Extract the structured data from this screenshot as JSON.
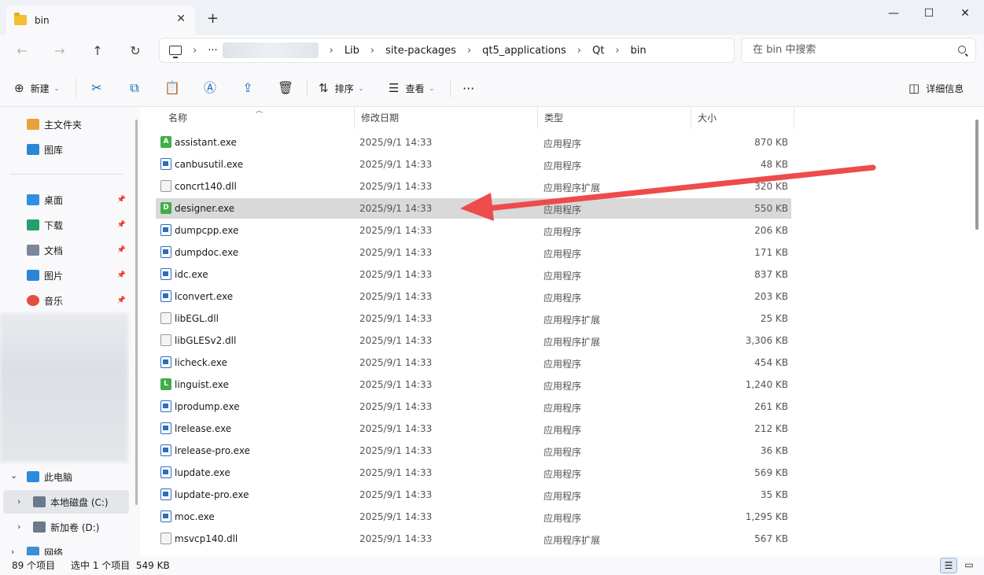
{
  "window": {
    "tab_title": "bin",
    "tab_close": "✕",
    "new_tab": "+",
    "controls": {
      "minimize": "—",
      "maximize": "☐",
      "close": "✕"
    }
  },
  "nav": {
    "back": "←",
    "forward": "→",
    "up": "↑",
    "refresh": "↻"
  },
  "address": {
    "ellipsis": "···",
    "crumbs": [
      "Lib",
      "site-packages",
      "qt5_applications",
      "Qt",
      "bin"
    ],
    "separator": "›"
  },
  "search": {
    "placeholder": "在 bin 中搜索"
  },
  "toolbar": {
    "new_label": "新建",
    "sort_label": "排序",
    "view_label": "查看",
    "more_label": "···",
    "details_label": "详细信息"
  },
  "sidebar": {
    "home": "主文件夹",
    "gallery": "图库",
    "quick": [
      {
        "label": "桌面",
        "color": "#2f8fe0"
      },
      {
        "label": "下载",
        "color": "#23a06b"
      },
      {
        "label": "文档",
        "color": "#7a8899"
      },
      {
        "label": "图片",
        "color": "#2b86d6"
      },
      {
        "label": "音乐",
        "color": "#e2503f"
      }
    ],
    "this_pc": "此电脑",
    "drive_c": "本地磁盘 (C:)",
    "drive_d": "新加卷 (D:)",
    "network": "网络"
  },
  "columns": {
    "name": "名称",
    "date": "修改日期",
    "type": "类型",
    "size": "大小"
  },
  "files": [
    {
      "name": "assistant.exe",
      "date": "2025/9/1 14:33",
      "type": "应用程序",
      "size": "870 KB",
      "icon": "green-a"
    },
    {
      "name": "canbusutil.exe",
      "date": "2025/9/1 14:33",
      "type": "应用程序",
      "size": "48 KB",
      "icon": "exe"
    },
    {
      "name": "concrt140.dll",
      "date": "2025/9/1 14:33",
      "type": "应用程序扩展",
      "size": "320 KB",
      "icon": "dll"
    },
    {
      "name": "designer.exe",
      "date": "2025/9/1 14:33",
      "type": "应用程序",
      "size": "550 KB",
      "icon": "green-d",
      "selected": true
    },
    {
      "name": "dumpcpp.exe",
      "date": "2025/9/1 14:33",
      "type": "应用程序",
      "size": "206 KB",
      "icon": "exe"
    },
    {
      "name": "dumpdoc.exe",
      "date": "2025/9/1 14:33",
      "type": "应用程序",
      "size": "171 KB",
      "icon": "exe"
    },
    {
      "name": "idc.exe",
      "date": "2025/9/1 14:33",
      "type": "应用程序",
      "size": "837 KB",
      "icon": "exe"
    },
    {
      "name": "lconvert.exe",
      "date": "2025/9/1 14:33",
      "type": "应用程序",
      "size": "203 KB",
      "icon": "exe"
    },
    {
      "name": "libEGL.dll",
      "date": "2025/9/1 14:33",
      "type": "应用程序扩展",
      "size": "25 KB",
      "icon": "dll"
    },
    {
      "name": "libGLESv2.dll",
      "date": "2025/9/1 14:33",
      "type": "应用程序扩展",
      "size": "3,306 KB",
      "icon": "dll"
    },
    {
      "name": "licheck.exe",
      "date": "2025/9/1 14:33",
      "type": "应用程序",
      "size": "454 KB",
      "icon": "exe"
    },
    {
      "name": "linguist.exe",
      "date": "2025/9/1 14:33",
      "type": "应用程序",
      "size": "1,240 KB",
      "icon": "green-l"
    },
    {
      "name": "lprodump.exe",
      "date": "2025/9/1 14:33",
      "type": "应用程序",
      "size": "261 KB",
      "icon": "exe"
    },
    {
      "name": "lrelease.exe",
      "date": "2025/9/1 14:33",
      "type": "应用程序",
      "size": "212 KB",
      "icon": "exe"
    },
    {
      "name": "lrelease-pro.exe",
      "date": "2025/9/1 14:33",
      "type": "应用程序",
      "size": "36 KB",
      "icon": "exe"
    },
    {
      "name": "lupdate.exe",
      "date": "2025/9/1 14:33",
      "type": "应用程序",
      "size": "569 KB",
      "icon": "exe"
    },
    {
      "name": "lupdate-pro.exe",
      "date": "2025/9/1 14:33",
      "type": "应用程序",
      "size": "35 KB",
      "icon": "exe"
    },
    {
      "name": "moc.exe",
      "date": "2025/9/1 14:33",
      "type": "应用程序",
      "size": "1,295 KB",
      "icon": "exe"
    },
    {
      "name": "msvcp140.dll",
      "date": "2025/9/1 14:33",
      "type": "应用程序扩展",
      "size": "567 KB",
      "icon": "dll"
    }
  ],
  "status": {
    "count": "89 个项目",
    "selection": "选中 1 个项目  549 KB"
  },
  "annotation": {
    "arrow_color": "#ee4b4b"
  }
}
